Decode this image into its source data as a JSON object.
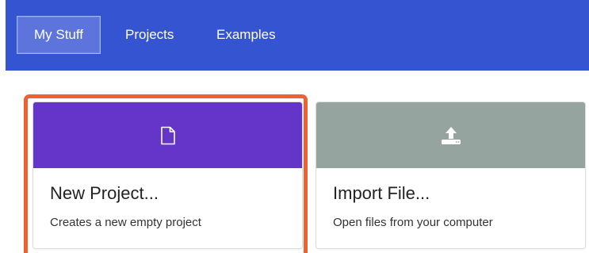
{
  "nav": {
    "tabs": [
      {
        "label": "My Stuff",
        "active": true
      },
      {
        "label": "Projects",
        "active": false
      },
      {
        "label": "Examples",
        "active": false
      }
    ],
    "background_color": "#3454d1"
  },
  "cards": [
    {
      "title": "New Project...",
      "description": "Creates a new empty project",
      "icon": "file-icon",
      "header_color": "#6535c9",
      "highlighted": true
    },
    {
      "title": "Import File...",
      "description": "Open files from your computer",
      "icon": "upload-icon",
      "header_color": "#95a49f",
      "highlighted": false
    }
  ],
  "highlight_color": "#ee6232"
}
